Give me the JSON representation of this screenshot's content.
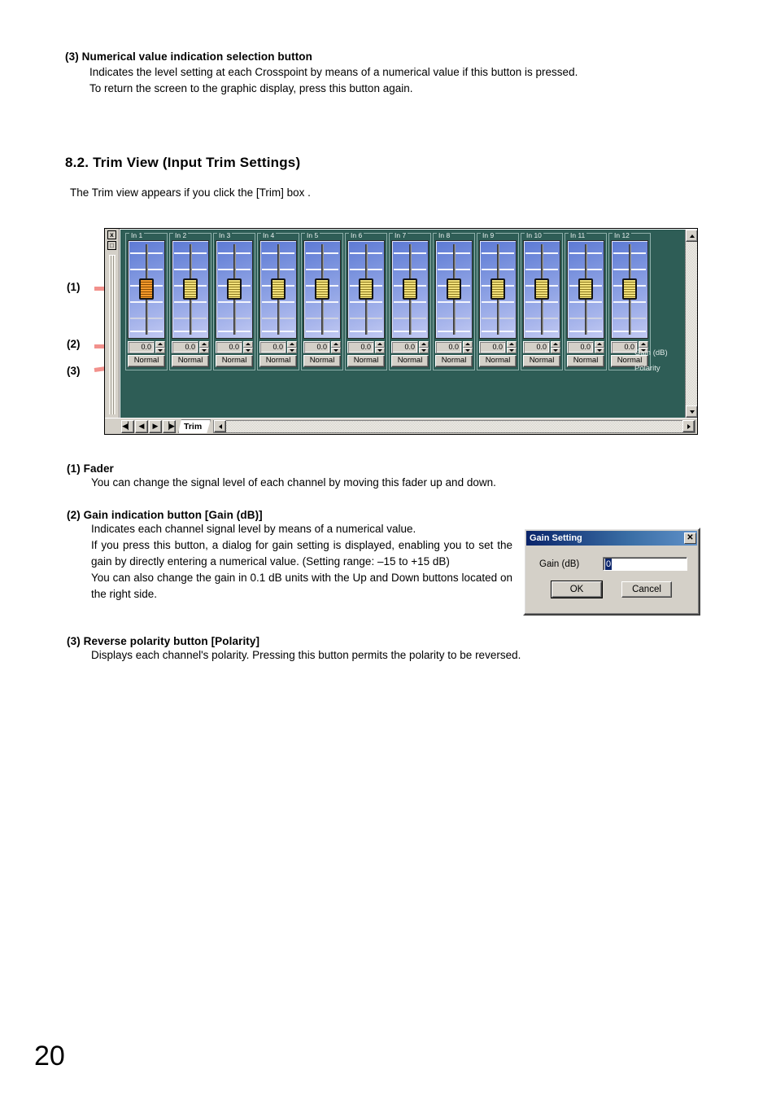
{
  "page": {
    "number": "20"
  },
  "top_block": {
    "heading": "(3)  Numerical value indication selection button",
    "line1": "Indicates the level setting at each Crosspoint by means of a numerical value if this button is pressed.",
    "line2": "To return the screen to the graphic display, press this button again."
  },
  "section": {
    "title": "8.2. Trim View (Input Trim Settings)",
    "intro": "The Trim view appears if you click the [Trim] box ."
  },
  "callouts": [
    {
      "id": "1",
      "label": "(1)"
    },
    {
      "id": "2",
      "label": "(2)"
    },
    {
      "id": "3",
      "label": "(3)"
    }
  ],
  "trim_view": {
    "window_controls": {
      "close": "x",
      "restore": "□"
    },
    "captions": {
      "gain": "Gain (dB)",
      "polarity": "Polarity"
    },
    "channels": [
      {
        "legend": "In 1",
        "gain": "0.0",
        "polarity": "Normal",
        "knob": "active"
      },
      {
        "legend": "In 2",
        "gain": "0.0",
        "polarity": "Normal",
        "knob": "normal"
      },
      {
        "legend": "In 3",
        "gain": "0.0",
        "polarity": "Normal",
        "knob": "normal"
      },
      {
        "legend": "In 4",
        "gain": "0.0",
        "polarity": "Normal",
        "knob": "normal"
      },
      {
        "legend": "In 5",
        "gain": "0.0",
        "polarity": "Normal",
        "knob": "normal"
      },
      {
        "legend": "In 6",
        "gain": "0.0",
        "polarity": "Normal",
        "knob": "normal"
      },
      {
        "legend": "In 7",
        "gain": "0.0",
        "polarity": "Normal",
        "knob": "normal"
      },
      {
        "legend": "In 8",
        "gain": "0.0",
        "polarity": "Normal",
        "knob": "normal"
      },
      {
        "legend": "In 9",
        "gain": "0.0",
        "polarity": "Normal",
        "knob": "normal"
      },
      {
        "legend": "In 10",
        "gain": "0.0",
        "polarity": "Normal",
        "knob": "normal"
      },
      {
        "legend": "In 11",
        "gain": "0.0",
        "polarity": "Normal",
        "knob": "normal"
      },
      {
        "legend": "In 12",
        "gain": "0.0",
        "polarity": "Normal",
        "knob": "normal"
      }
    ],
    "footer": {
      "nav": [
        {
          "name": "first",
          "glyph": "◀▏"
        },
        {
          "name": "previous",
          "glyph": "◀"
        },
        {
          "name": "next",
          "glyph": "▶"
        },
        {
          "name": "last",
          "glyph": "▕▶"
        }
      ],
      "tab": "Trim"
    },
    "colors": {
      "workspace": "#2e5d56",
      "chrome": "#d4d0c8",
      "fader_track_top": "#5c79d4",
      "fader_track_bottom": "#c2caf2",
      "knob_active": "#f59a2b",
      "knob_normal": "#f2e07a",
      "callout_line": "#f2918c"
    }
  },
  "gain_dialog": {
    "title": "Gain Setting",
    "close_label": "✕",
    "field_label": "Gain (dB)",
    "field_value": "0",
    "buttons": {
      "ok": "OK",
      "cancel": "Cancel"
    },
    "titlebar_color": "#0a246a"
  },
  "descriptions": [
    {
      "heading": "(1) Fader",
      "lines": [
        "You can change the signal level of each channel by moving this fader up and down."
      ]
    },
    {
      "heading": "(2) Gain indication button [Gain (dB)]",
      "lines": [
        "Indicates each channel signal level by means of a numerical value.",
        "If you press this button, a dialog for gain setting is displayed, enabling you to set the gain by directly entering a numerical value. (Setting range: –15 to +15 dB)",
        "You can also change the gain in 0.1 dB units with the Up and Down buttons located on the right side."
      ]
    },
    {
      "heading": "(3) Reverse polarity button [Polarity]",
      "lines": [
        "Displays each channel's polarity. Pressing this button permits the polarity to be reversed."
      ]
    }
  ]
}
